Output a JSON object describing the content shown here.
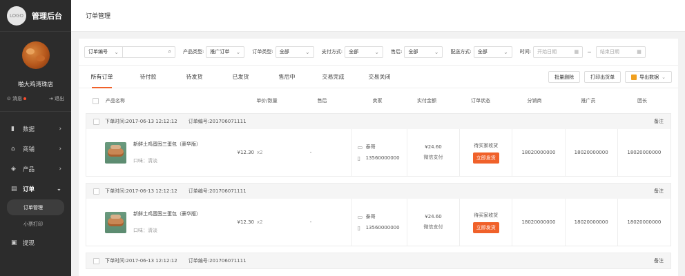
{
  "brand": {
    "logo_text": "LOGO",
    "title": "管理后台"
  },
  "profile": {
    "shop_name": "啪大鸡湾珠店",
    "message_label": "消息",
    "logout_label": "退出"
  },
  "nav": {
    "items": [
      {
        "label": "数据",
        "icon": "bar-chart-icon"
      },
      {
        "label": "商铺",
        "icon": "home-icon"
      },
      {
        "label": "产品",
        "icon": "layers-icon"
      },
      {
        "label": "订单",
        "icon": "document-icon"
      }
    ],
    "order_sub": [
      {
        "label": "订单管理"
      },
      {
        "label": "小票打印"
      }
    ],
    "withdraw": {
      "label": "提现",
      "icon": "wallet-icon"
    }
  },
  "topbar": {
    "title": "订单管理"
  },
  "filters": {
    "order_no": {
      "select_label": "订单编号",
      "placeholder": ""
    },
    "product_type": {
      "label": "产品类型:",
      "value": "推广订单"
    },
    "order_type": {
      "label": "订单类型:",
      "value": "全部"
    },
    "payment": {
      "label": "支付方式:",
      "value": "全部"
    },
    "after_sale": {
      "label": "售后:",
      "value": "全部"
    },
    "delivery": {
      "label": "配送方式:",
      "value": "全部"
    },
    "time": {
      "label": "时间:",
      "start_placeholder": "开始日期",
      "end_placeholder": "结束日期",
      "separator": "~"
    }
  },
  "tabs": [
    {
      "label": "所有订单",
      "active": true
    },
    {
      "label": "待付款"
    },
    {
      "label": "待发货"
    },
    {
      "label": "已发货"
    },
    {
      "label": "售后中"
    },
    {
      "label": "交易完成"
    },
    {
      "label": "交易关闭"
    }
  ],
  "tools": {
    "batch_delete": "批量删除",
    "print": "打印出货单",
    "export": "导出数据"
  },
  "columns": {
    "product": "产品名称",
    "price_qty": "单价/数量",
    "after_sale": "售后",
    "seller": "卖家",
    "paid": "实付金额",
    "status": "订单状态",
    "distributor": "分销商",
    "promoter": "推广员",
    "leader": "团长"
  },
  "orders": [
    {
      "order_time_label": "下单时间:",
      "order_time": "2017-06-13 12:12:12",
      "order_no_label": "订单编号:",
      "order_no": "201706071111",
      "note_label": "备注",
      "product_name": "新鲜土鸡蛋囤三蛋包（豪华版）",
      "spec": "口味：清淡",
      "price": "¥12.30",
      "qty": "x2",
      "after_sale": "-",
      "seller_name": "泰哥",
      "seller_phone": "13560000000",
      "paid": "¥24.60",
      "pay_method": "微信支付",
      "status": "待买家收货",
      "ship_btn": "立即发货",
      "distributor": "18020000000",
      "promoter": "18020000000",
      "leader": "18020000000"
    },
    {
      "order_time_label": "下单时间:",
      "order_time": "2017-06-13 12:12:12",
      "order_no_label": "订单编号:",
      "order_no": "201706071111",
      "note_label": "备注",
      "product_name": "新鲜土鸡蛋囤三蛋包（豪华版）",
      "spec": "口味：清淡",
      "price": "¥12.30",
      "qty": "x2",
      "after_sale": "-",
      "seller_name": "泰哥",
      "seller_phone": "13560000000",
      "paid": "¥24.60",
      "pay_method": "微信支付",
      "status": "待买家收货",
      "ship_btn": "立即发货",
      "distributor": "18020000000",
      "promoter": "18020000000",
      "leader": "18020000000"
    },
    {
      "order_time_label": "下单时间:",
      "order_time": "2017-06-13 12:12:12",
      "order_no_label": "订单编号:",
      "order_no": "201706071111",
      "note_label": "备注"
    }
  ]
}
